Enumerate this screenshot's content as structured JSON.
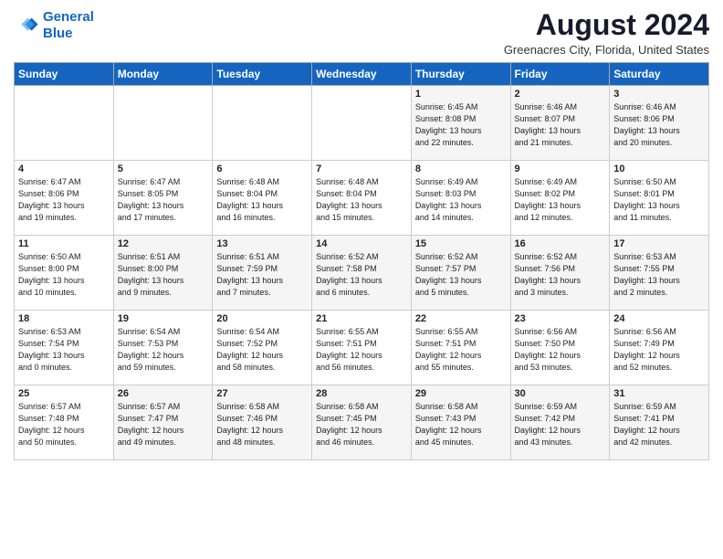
{
  "logo": {
    "line1": "General",
    "line2": "Blue"
  },
  "title": "August 2024",
  "location": "Greenacres City, Florida, United States",
  "weekdays": [
    "Sunday",
    "Monday",
    "Tuesday",
    "Wednesday",
    "Thursday",
    "Friday",
    "Saturday"
  ],
  "weeks": [
    [
      {
        "day": "",
        "info": ""
      },
      {
        "day": "",
        "info": ""
      },
      {
        "day": "",
        "info": ""
      },
      {
        "day": "",
        "info": ""
      },
      {
        "day": "1",
        "info": "Sunrise: 6:45 AM\nSunset: 8:08 PM\nDaylight: 13 hours\nand 22 minutes."
      },
      {
        "day": "2",
        "info": "Sunrise: 6:46 AM\nSunset: 8:07 PM\nDaylight: 13 hours\nand 21 minutes."
      },
      {
        "day": "3",
        "info": "Sunrise: 6:46 AM\nSunset: 8:06 PM\nDaylight: 13 hours\nand 20 minutes."
      }
    ],
    [
      {
        "day": "4",
        "info": "Sunrise: 6:47 AM\nSunset: 8:06 PM\nDaylight: 13 hours\nand 19 minutes."
      },
      {
        "day": "5",
        "info": "Sunrise: 6:47 AM\nSunset: 8:05 PM\nDaylight: 13 hours\nand 17 minutes."
      },
      {
        "day": "6",
        "info": "Sunrise: 6:48 AM\nSunset: 8:04 PM\nDaylight: 13 hours\nand 16 minutes."
      },
      {
        "day": "7",
        "info": "Sunrise: 6:48 AM\nSunset: 8:04 PM\nDaylight: 13 hours\nand 15 minutes."
      },
      {
        "day": "8",
        "info": "Sunrise: 6:49 AM\nSunset: 8:03 PM\nDaylight: 13 hours\nand 14 minutes."
      },
      {
        "day": "9",
        "info": "Sunrise: 6:49 AM\nSunset: 8:02 PM\nDaylight: 13 hours\nand 12 minutes."
      },
      {
        "day": "10",
        "info": "Sunrise: 6:50 AM\nSunset: 8:01 PM\nDaylight: 13 hours\nand 11 minutes."
      }
    ],
    [
      {
        "day": "11",
        "info": "Sunrise: 6:50 AM\nSunset: 8:00 PM\nDaylight: 13 hours\nand 10 minutes."
      },
      {
        "day": "12",
        "info": "Sunrise: 6:51 AM\nSunset: 8:00 PM\nDaylight: 13 hours\nand 9 minutes."
      },
      {
        "day": "13",
        "info": "Sunrise: 6:51 AM\nSunset: 7:59 PM\nDaylight: 13 hours\nand 7 minutes."
      },
      {
        "day": "14",
        "info": "Sunrise: 6:52 AM\nSunset: 7:58 PM\nDaylight: 13 hours\nand 6 minutes."
      },
      {
        "day": "15",
        "info": "Sunrise: 6:52 AM\nSunset: 7:57 PM\nDaylight: 13 hours\nand 5 minutes."
      },
      {
        "day": "16",
        "info": "Sunrise: 6:52 AM\nSunset: 7:56 PM\nDaylight: 13 hours\nand 3 minutes."
      },
      {
        "day": "17",
        "info": "Sunrise: 6:53 AM\nSunset: 7:55 PM\nDaylight: 13 hours\nand 2 minutes."
      }
    ],
    [
      {
        "day": "18",
        "info": "Sunrise: 6:53 AM\nSunset: 7:54 PM\nDaylight: 13 hours\nand 0 minutes."
      },
      {
        "day": "19",
        "info": "Sunrise: 6:54 AM\nSunset: 7:53 PM\nDaylight: 12 hours\nand 59 minutes."
      },
      {
        "day": "20",
        "info": "Sunrise: 6:54 AM\nSunset: 7:52 PM\nDaylight: 12 hours\nand 58 minutes."
      },
      {
        "day": "21",
        "info": "Sunrise: 6:55 AM\nSunset: 7:51 PM\nDaylight: 12 hours\nand 56 minutes."
      },
      {
        "day": "22",
        "info": "Sunrise: 6:55 AM\nSunset: 7:51 PM\nDaylight: 12 hours\nand 55 minutes."
      },
      {
        "day": "23",
        "info": "Sunrise: 6:56 AM\nSunset: 7:50 PM\nDaylight: 12 hours\nand 53 minutes."
      },
      {
        "day": "24",
        "info": "Sunrise: 6:56 AM\nSunset: 7:49 PM\nDaylight: 12 hours\nand 52 minutes."
      }
    ],
    [
      {
        "day": "25",
        "info": "Sunrise: 6:57 AM\nSunset: 7:48 PM\nDaylight: 12 hours\nand 50 minutes."
      },
      {
        "day": "26",
        "info": "Sunrise: 6:57 AM\nSunset: 7:47 PM\nDaylight: 12 hours\nand 49 minutes."
      },
      {
        "day": "27",
        "info": "Sunrise: 6:58 AM\nSunset: 7:46 PM\nDaylight: 12 hours\nand 48 minutes."
      },
      {
        "day": "28",
        "info": "Sunrise: 6:58 AM\nSunset: 7:45 PM\nDaylight: 12 hours\nand 46 minutes."
      },
      {
        "day": "29",
        "info": "Sunrise: 6:58 AM\nSunset: 7:43 PM\nDaylight: 12 hours\nand 45 minutes."
      },
      {
        "day": "30",
        "info": "Sunrise: 6:59 AM\nSunset: 7:42 PM\nDaylight: 12 hours\nand 43 minutes."
      },
      {
        "day": "31",
        "info": "Sunrise: 6:59 AM\nSunset: 7:41 PM\nDaylight: 12 hours\nand 42 minutes."
      }
    ]
  ]
}
